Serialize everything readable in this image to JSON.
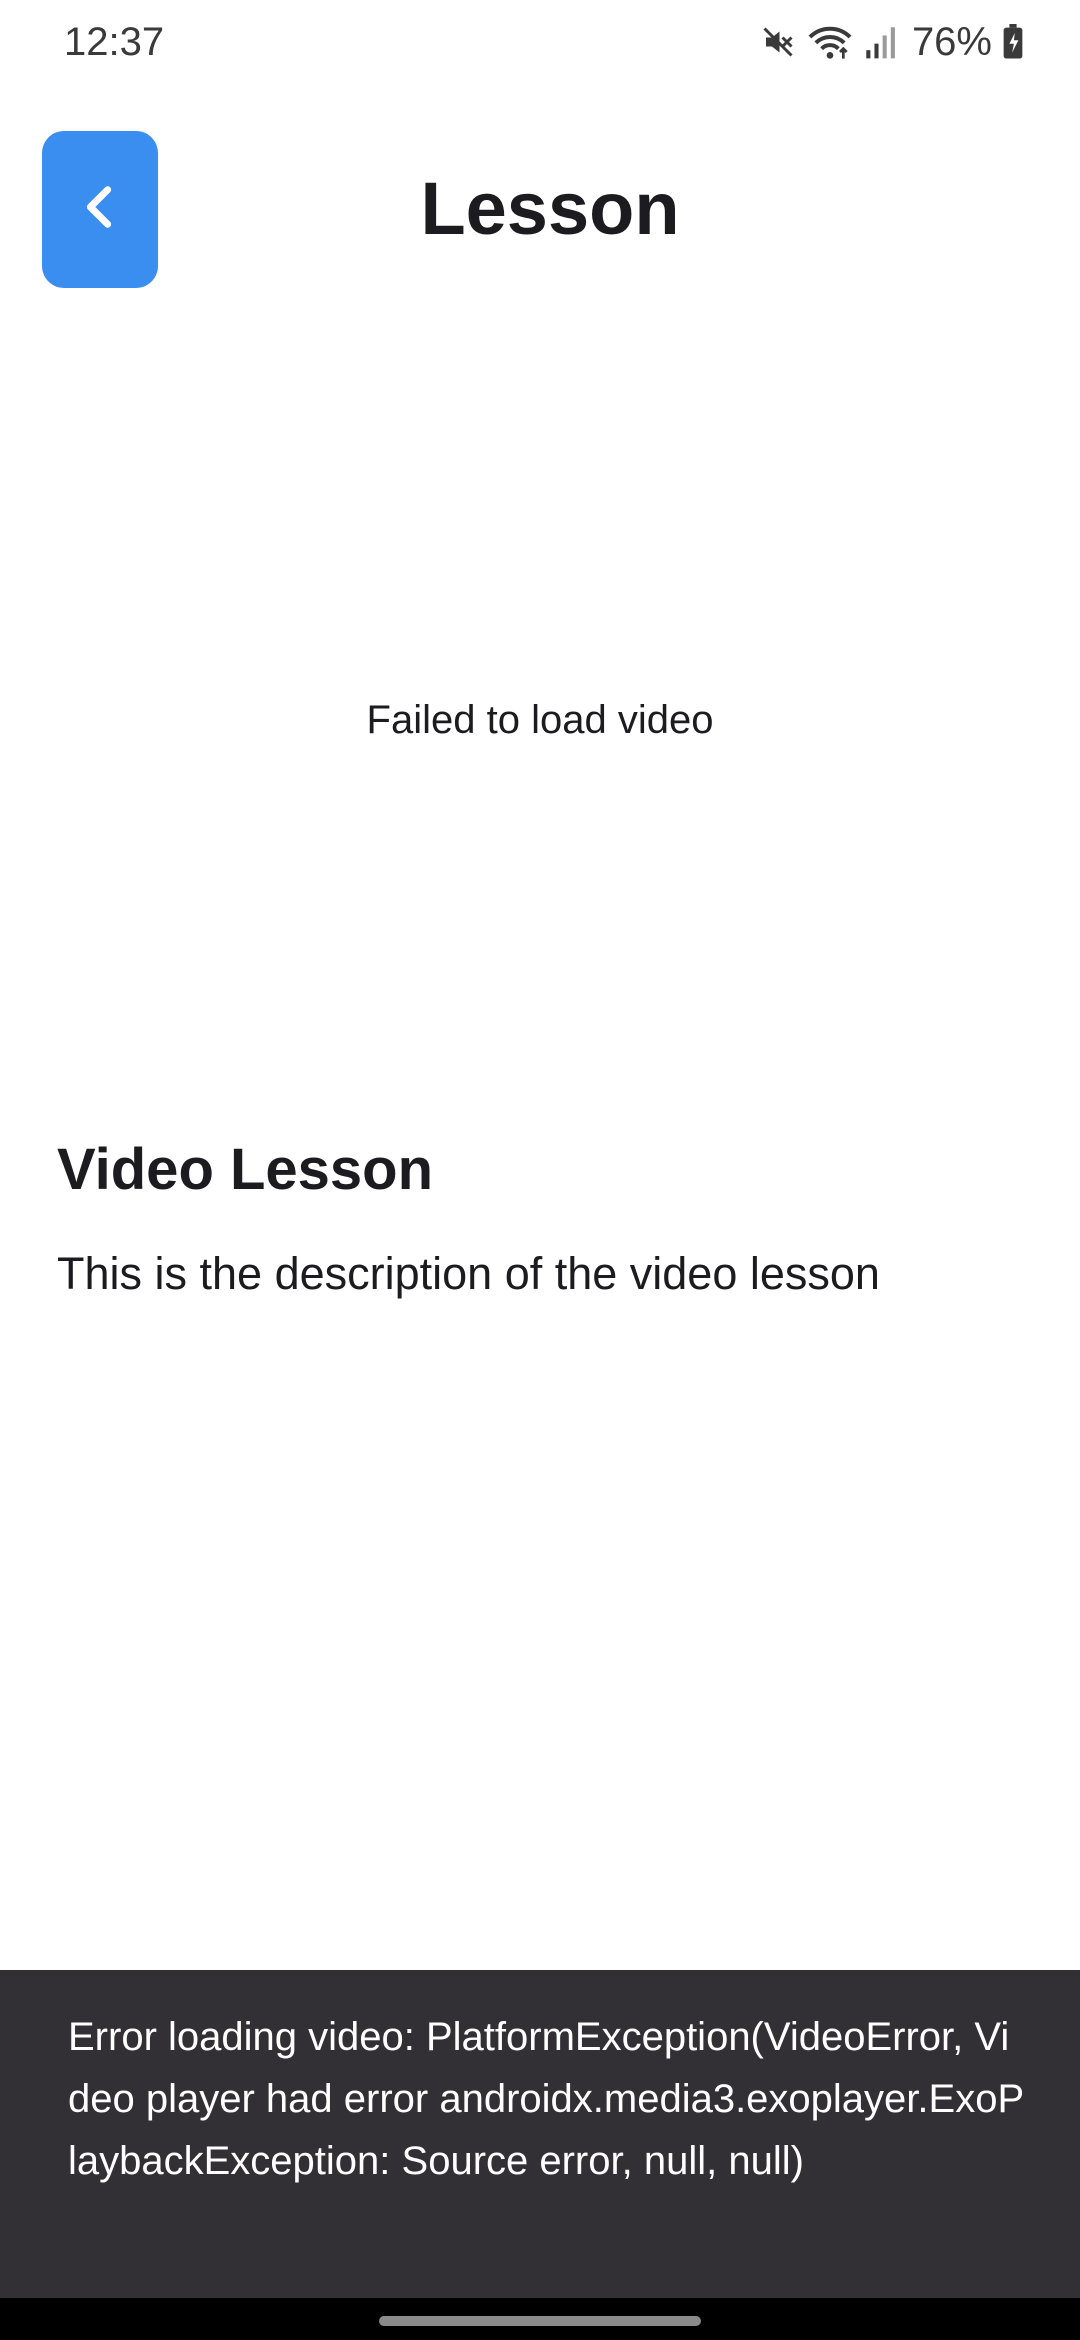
{
  "status_bar": {
    "time": "12:37",
    "battery_percent": "76%",
    "icons": [
      "mute-icon",
      "wifi-icon",
      "signal-icon",
      "battery-icon"
    ]
  },
  "app_bar": {
    "title": "Lesson",
    "back_icon": "chevron-left-icon",
    "accent_color": "#3a8ef0"
  },
  "video": {
    "error_message": "Failed to load video"
  },
  "lesson": {
    "title": "Video Lesson",
    "description": "This is the description of the video lesson"
  },
  "snackbar": {
    "message": "Error loading video: PlatformException(VideoError, Video player had error androidx.media3.exoplayer.ExoPlaybackException: Source error, null, null)",
    "background_color": "#323035"
  }
}
